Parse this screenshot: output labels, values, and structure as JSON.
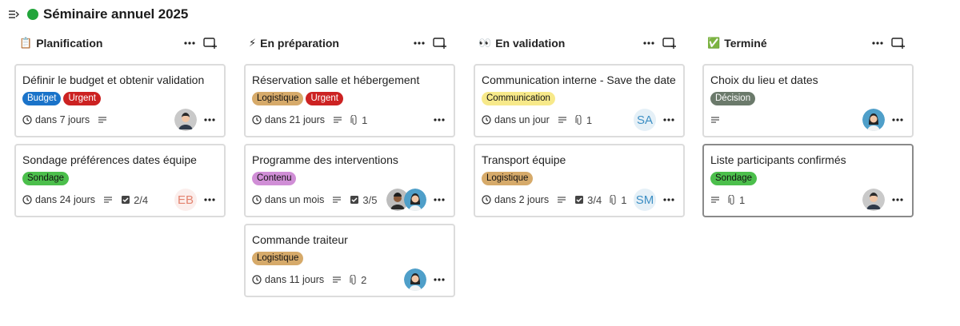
{
  "board": {
    "title": "Séminaire annuel 2025"
  },
  "columns": [
    {
      "title": "Planification",
      "emoji": "📋",
      "cards": [
        {
          "title": "Définir le budget et obtenir validation",
          "tags": [
            {
              "label": "Budget",
              "bg": "#1a73c9",
              "fg": "#ffffff"
            },
            {
              "label": "Urgent",
              "bg": "#cc2222",
              "fg": "#ffffff"
            }
          ],
          "due": "dans 7 jours",
          "avatar": "man-gray"
        },
        {
          "title": "Sondage préférences dates équipe",
          "tags": [
            {
              "label": "Sondage",
              "bg": "#4cbf4c",
              "fg": "#111111"
            }
          ],
          "due": "dans 24 jours",
          "checklist": "2/4",
          "initials": "EB"
        }
      ]
    },
    {
      "title": "En préparation",
      "emoji": "⚡",
      "cards": [
        {
          "title": "Réservation salle et hébergement",
          "tags": [
            {
              "label": "Logistique",
              "bg": "#d6aa6a",
              "fg": "#111111"
            },
            {
              "label": "Urgent",
              "bg": "#cc2222",
              "fg": "#ffffff"
            }
          ],
          "due": "dans 21 jours",
          "attachments": "1"
        },
        {
          "title": "Programme des interventions",
          "tags": [
            {
              "label": "Contenu",
              "bg": "#d08ed6",
              "fg": "#111111"
            }
          ],
          "due": "dans un mois",
          "checklist": "3/5",
          "avatar": "pair"
        },
        {
          "title": "Commande traiteur",
          "tags": [
            {
              "label": "Logistique",
              "bg": "#d6aa6a",
              "fg": "#111111"
            }
          ],
          "due": "dans 11 jours",
          "attachments": "2",
          "avatar": "woman-blue"
        }
      ]
    },
    {
      "title": "En validation",
      "emoji": "👀",
      "cards": [
        {
          "title": "Communication interne - Save the date",
          "tags": [
            {
              "label": "Communication",
              "bg": "#f7e98a",
              "fg": "#111111"
            }
          ],
          "due": "dans un jour",
          "attachments": "1",
          "initials": "SA"
        },
        {
          "title": "Transport équipe",
          "tags": [
            {
              "label": "Logistique",
              "bg": "#d6aa6a",
              "fg": "#111111"
            }
          ],
          "due": "dans 2 jours",
          "checklist": "3/4",
          "attachments": "1",
          "initials": "SM"
        }
      ]
    },
    {
      "title": "Terminé",
      "emoji": "✅",
      "cards": [
        {
          "title": "Choix du lieu et dates",
          "tags": [
            {
              "label": "Décision",
              "bg": "#6b7a6b",
              "fg": "#ffffff"
            }
          ],
          "avatar": "woman-blue"
        },
        {
          "title": "Liste participants confirmés",
          "tags": [
            {
              "label": "Sondage",
              "bg": "#4cbf4c",
              "fg": "#111111"
            }
          ],
          "attachments": "1",
          "avatar": "man-gray",
          "selected": true
        }
      ]
    }
  ],
  "colors": {
    "initials_EB": "#e3826e",
    "initials_SA": "#3d8fc4",
    "initials_SM": "#3d8fc4"
  }
}
